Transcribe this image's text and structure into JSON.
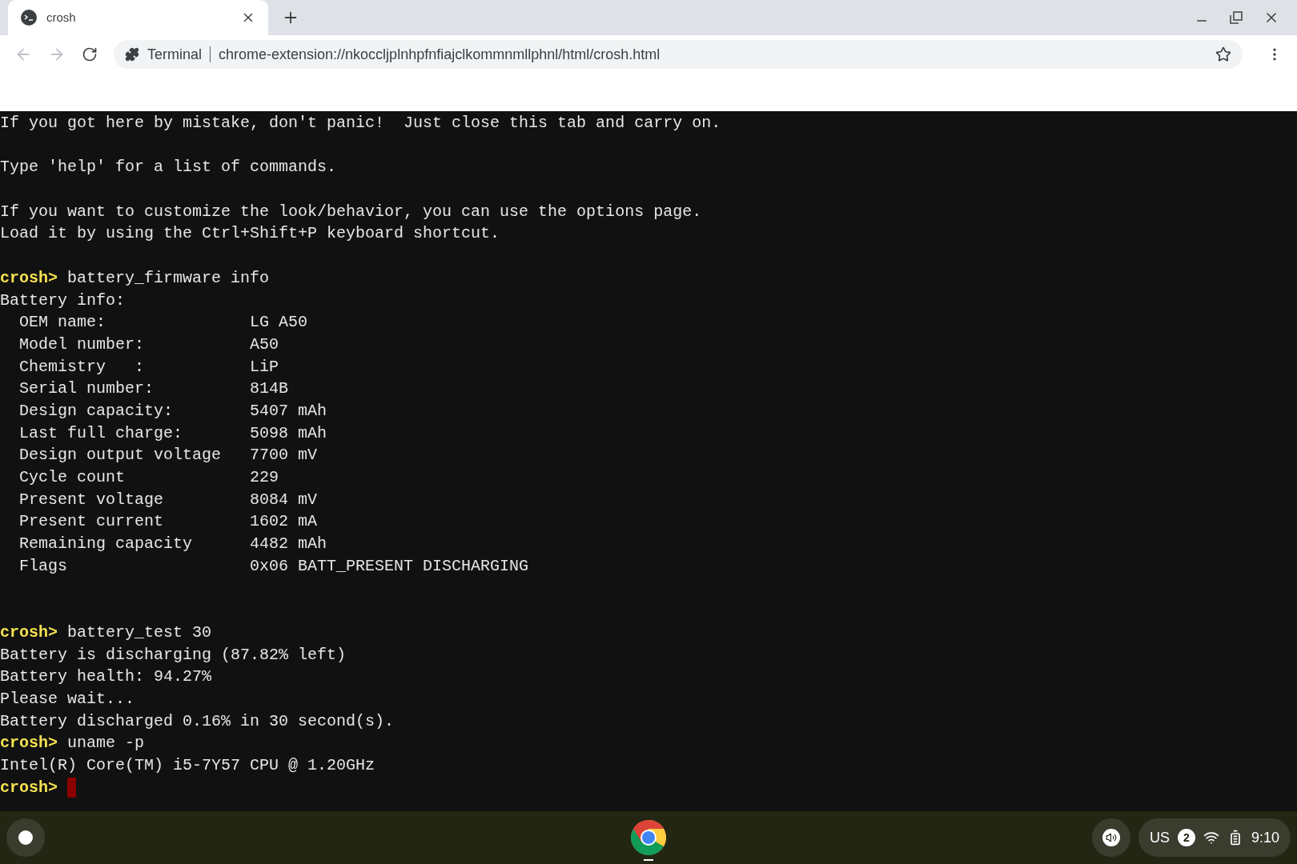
{
  "tab": {
    "title": "crosh",
    "selected": true
  },
  "omnibox": {
    "chip": "Terminal",
    "url": "chrome-extension://nkoccljplnhpfnfiajclkommnmllphnl/html/crosh.html"
  },
  "terminal": [
    {
      "kind": "text",
      "text": "If you got here by mistake, don't panic!  Just close this tab and carry on."
    },
    {
      "kind": "blank"
    },
    {
      "kind": "text",
      "text": "Type 'help' for a list of commands."
    },
    {
      "kind": "blank"
    },
    {
      "kind": "text",
      "text": "If you want to customize the look/behavior, you can use the options page."
    },
    {
      "kind": "text",
      "text": "Load it by using the Ctrl+Shift+P keyboard shortcut."
    },
    {
      "kind": "blank"
    },
    {
      "kind": "prompt",
      "prompt": "crosh>",
      "command": "battery_firmware info"
    },
    {
      "kind": "text",
      "text": "Battery info:"
    },
    {
      "kind": "pair",
      "label": "OEM name:",
      "value": "LG A50"
    },
    {
      "kind": "pair",
      "label": "Model number:",
      "value": "A50"
    },
    {
      "kind": "pair",
      "label": "Chemistry   :",
      "value": "LiP"
    },
    {
      "kind": "pair",
      "label": "Serial number:",
      "value": "814B"
    },
    {
      "kind": "pair",
      "label": "Design capacity:",
      "value": "5407 mAh"
    },
    {
      "kind": "pair",
      "label": "Last full charge:",
      "value": "5098 mAh"
    },
    {
      "kind": "pair",
      "label": "Design output voltage",
      "value": "7700 mV"
    },
    {
      "kind": "pair",
      "label": "Cycle count",
      "value": "229"
    },
    {
      "kind": "pair",
      "label": "Present voltage",
      "value": "8084 mV"
    },
    {
      "kind": "pair",
      "label": "Present current",
      "value": "1602 mA"
    },
    {
      "kind": "pair",
      "label": "Remaining capacity",
      "value": "4482 mAh"
    },
    {
      "kind": "pair",
      "label": "Flags",
      "value": "0x06 BATT_PRESENT DISCHARGING"
    },
    {
      "kind": "blank"
    },
    {
      "kind": "blank"
    },
    {
      "kind": "prompt",
      "prompt": "crosh>",
      "command": "battery_test 30"
    },
    {
      "kind": "text",
      "text": "Battery is discharging (87.82% left)"
    },
    {
      "kind": "text",
      "text": "Battery health: 94.27%"
    },
    {
      "kind": "text",
      "text": "Please wait..."
    },
    {
      "kind": "text",
      "text": "Battery discharged 0.16% in 30 second(s)."
    },
    {
      "kind": "prompt",
      "prompt": "crosh>",
      "command": "uname -p"
    },
    {
      "kind": "text",
      "text": "Intel(R) Core(TM) i5-7Y57 CPU @ 1.20GHz"
    },
    {
      "kind": "input",
      "prompt": "crosh>"
    }
  ],
  "tray": {
    "keyboard": "US",
    "notifications": "2",
    "time": "9:10"
  }
}
